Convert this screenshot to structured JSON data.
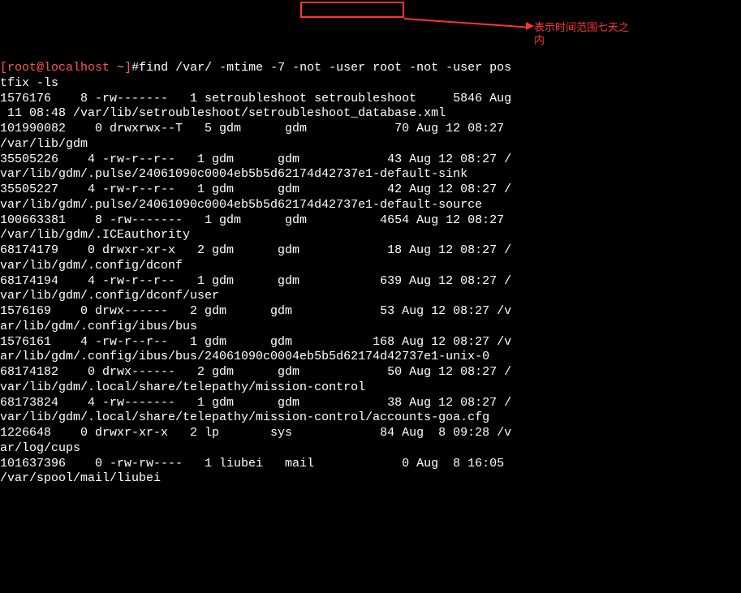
{
  "prompt": {
    "user_host": "[root@localhost ",
    "tilde": "~",
    "bracket": "]",
    "hash": "#",
    "cmd_pre": "find /var/ ",
    "cmd_box": "-mtime -7 ",
    "cmd_post": "-not -user root -not -user pos",
    "cmd_wrap": "tfix -ls"
  },
  "annotation": {
    "text1": "表示时间范围七天之",
    "text2": "内"
  },
  "lines": [
    "1576176    8 -rw-------   1 setroubleshoot setroubleshoot     5846 Aug",
    " 11 08:48 /var/lib/setroubleshoot/setroubleshoot_database.xml",
    "101990082    0 drwxrwx--T   5 gdm      gdm            70 Aug 12 08:27 ",
    "/var/lib/gdm",
    "35505226    4 -rw-r--r--   1 gdm      gdm            43 Aug 12 08:27 /",
    "var/lib/gdm/.pulse/24061090c0004eb5b5d62174d42737e1-default-sink",
    "35505227    4 -rw-r--r--   1 gdm      gdm            42 Aug 12 08:27 /",
    "var/lib/gdm/.pulse/24061090c0004eb5b5d62174d42737e1-default-source",
    "100663381    8 -rw-------   1 gdm      gdm          4654 Aug 12 08:27 ",
    "/var/lib/gdm/.ICEauthority",
    "68174179    0 drwxr-xr-x   2 gdm      gdm            18 Aug 12 08:27 /",
    "var/lib/gdm/.config/dconf",
    "68174194    4 -rw-r--r--   1 gdm      gdm           639 Aug 12 08:27 /",
    "var/lib/gdm/.config/dconf/user",
    "1576169    0 drwx------   2 gdm      gdm            53 Aug 12 08:27 /v",
    "ar/lib/gdm/.config/ibus/bus",
    "1576161    4 -rw-r--r--   1 gdm      gdm           168 Aug 12 08:27 /v",
    "ar/lib/gdm/.config/ibus/bus/24061090c0004eb5b5d62174d42737e1-unix-0",
    "68174182    0 drwx------   2 gdm      gdm            50 Aug 12 08:27 /",
    "var/lib/gdm/.local/share/telepathy/mission-control",
    "68173824    4 -rw-------   1 gdm      gdm            38 Aug 12 08:27 /",
    "var/lib/gdm/.local/share/telepathy/mission-control/accounts-goa.cfg",
    "1226648    0 drwxr-xr-x   2 lp       sys            84 Aug  8 09:28 /v",
    "ar/log/cups",
    "101637396    0 -rw-rw----   1 liubei   mail            0 Aug  8 16:05 ",
    "/var/spool/mail/liubei"
  ]
}
